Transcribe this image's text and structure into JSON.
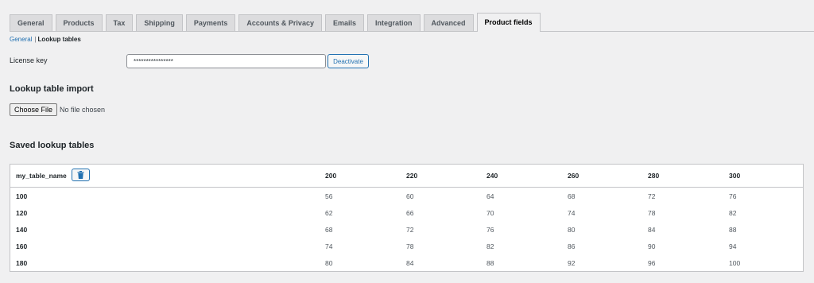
{
  "tabs": [
    {
      "label": "General",
      "active": false
    },
    {
      "label": "Products",
      "active": false
    },
    {
      "label": "Tax",
      "active": false
    },
    {
      "label": "Shipping",
      "active": false
    },
    {
      "label": "Payments",
      "active": false
    },
    {
      "label": "Accounts & Privacy",
      "active": false
    },
    {
      "label": "Emails",
      "active": false
    },
    {
      "label": "Integration",
      "active": false
    },
    {
      "label": "Advanced",
      "active": false
    },
    {
      "label": "Product fields",
      "active": true
    }
  ],
  "subnav": {
    "link": "General",
    "separator": "|",
    "current": "Lookup tables"
  },
  "license": {
    "label": "License key",
    "value": "****************",
    "button": "Deactivate"
  },
  "import": {
    "title": "Lookup table import",
    "choose_file": "Choose File",
    "status": "No file chosen"
  },
  "saved": {
    "title": "Saved lookup tables"
  },
  "table": {
    "name": "my_table_name",
    "delete_icon": "trash-icon",
    "columns": [
      "200",
      "220",
      "240",
      "260",
      "280",
      "300"
    ],
    "rows": [
      {
        "label": "100",
        "values": [
          "56",
          "60",
          "64",
          "68",
          "72",
          "76"
        ]
      },
      {
        "label": "120",
        "values": [
          "62",
          "66",
          "70",
          "74",
          "78",
          "82"
        ]
      },
      {
        "label": "140",
        "values": [
          "68",
          "72",
          "76",
          "80",
          "84",
          "88"
        ]
      },
      {
        "label": "160",
        "values": [
          "74",
          "78",
          "82",
          "86",
          "90",
          "94"
        ]
      },
      {
        "label": "180",
        "values": [
          "80",
          "84",
          "88",
          "92",
          "96",
          "100"
        ]
      }
    ]
  },
  "colors": {
    "background": "#f0f0f1",
    "accent": "#2271b1",
    "border": "#c3c4c7"
  }
}
